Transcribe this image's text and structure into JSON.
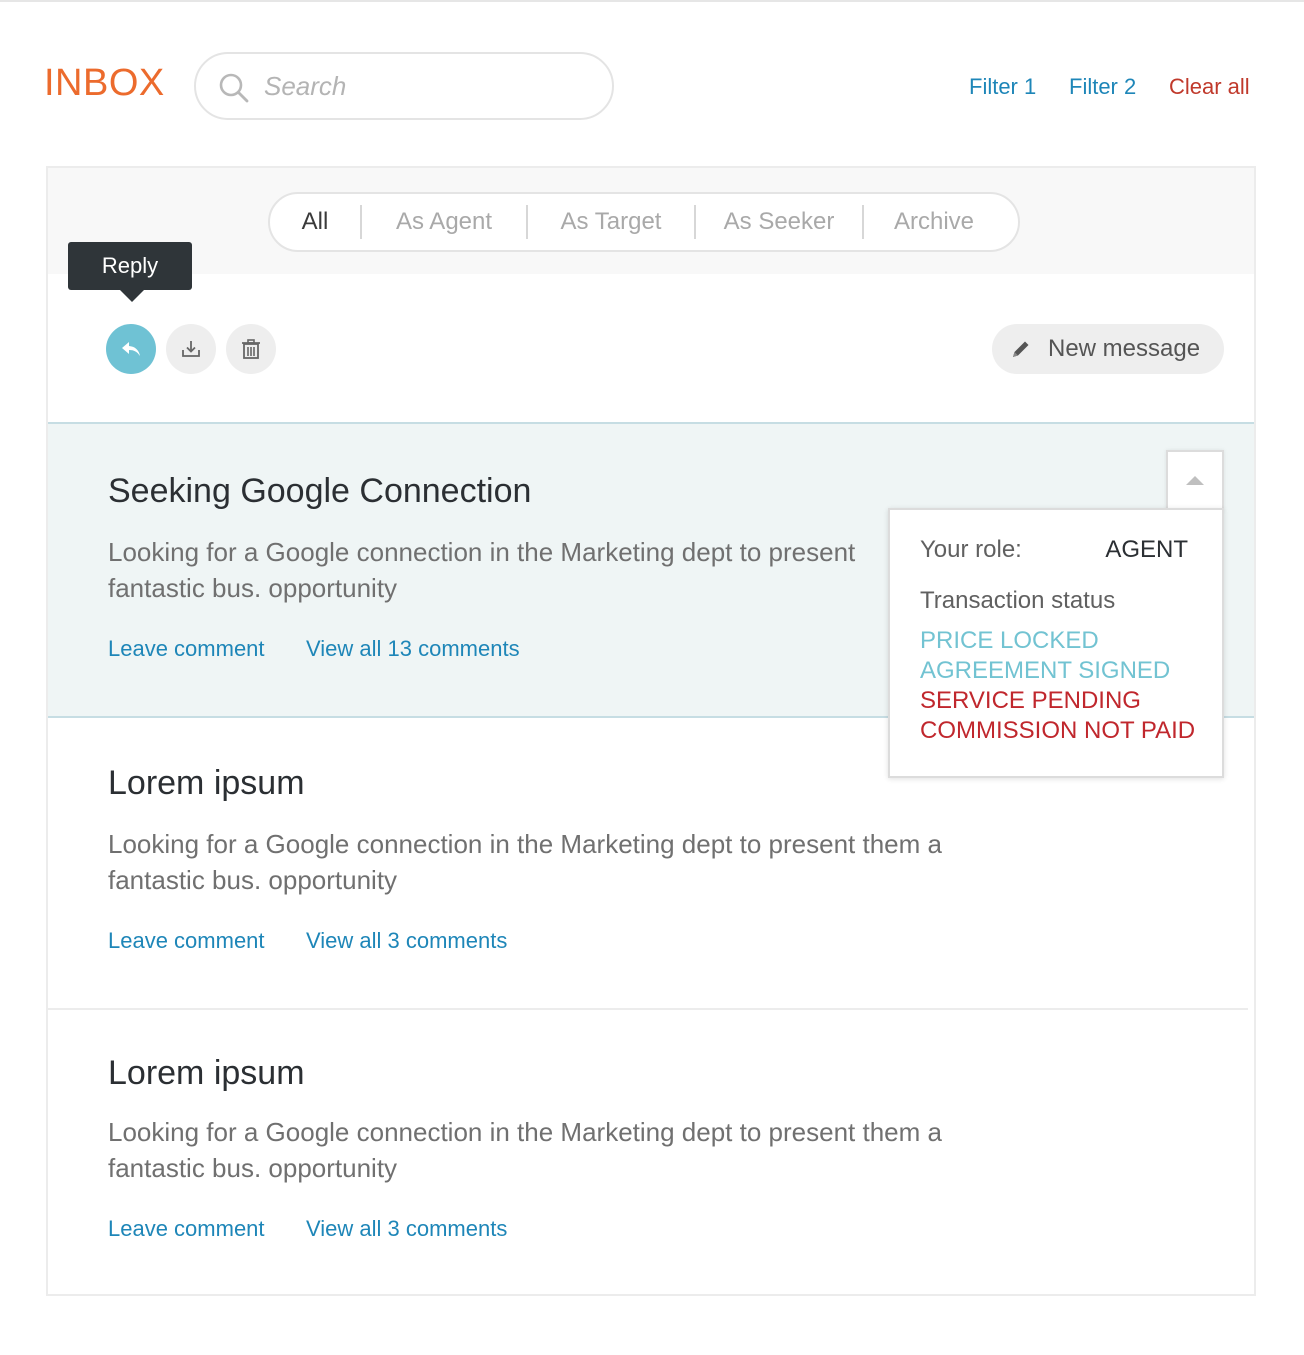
{
  "header": {
    "title": "INBOX",
    "search_placeholder": "Search",
    "search_value": "",
    "filters": [
      "Filter 1",
      "Filter 2"
    ],
    "clear_label": "Clear all"
  },
  "tabs": [
    "All",
    "As Agent",
    "As Target",
    "As Seeker",
    "Archive"
  ],
  "active_tab": "All",
  "toolbar": {
    "tooltip": "Reply",
    "new_message_label": "New message"
  },
  "messages": [
    {
      "title": "Seeking Google Connection",
      "body_line1": "Looking for a Google connection in the Marketing dept to present",
      "body_line2": "fantastic bus. opportunity",
      "leave_comment": "Leave comment",
      "view_comments": "View all 13 comments",
      "selected": true
    },
    {
      "title": "Lorem ipsum",
      "body_line1": "Looking for a Google connection in the Marketing dept to present them a",
      "body_line2": "fantastic bus. opportunity",
      "leave_comment": "Leave comment",
      "view_comments": "View all 3 comments"
    },
    {
      "title": "Lorem ipsum",
      "body_line1": "Looking for a Google connection in the Marketing dept to present them a",
      "body_line2": "fantastic bus. opportunity",
      "leave_comment": "Leave comment",
      "view_comments": "View all 3 comments"
    }
  ],
  "details": {
    "role_label": "Your role:",
    "role_value": "AGENT",
    "status_label": "Transaction status",
    "statuses": [
      {
        "text": "PRICE LOCKED",
        "color": "#72c3d2"
      },
      {
        "text": "AGREEMENT SIGNED",
        "color": "#72c3d2"
      },
      {
        "text": "SERVICE PENDING",
        "color": "#c0272d"
      },
      {
        "text": "COMMISSION NOT PAID",
        "color": "#c0272d"
      }
    ]
  },
  "colors": {
    "brand": "#ec6b2d",
    "link": "#1e86b8",
    "danger": "#c0392b",
    "reply_button": "#6fc2d4",
    "selected_row": "#eff5f5"
  },
  "icons": [
    "search-icon",
    "reply-icon",
    "download-icon",
    "trash-icon",
    "pencil-icon",
    "caret-up-icon"
  ]
}
